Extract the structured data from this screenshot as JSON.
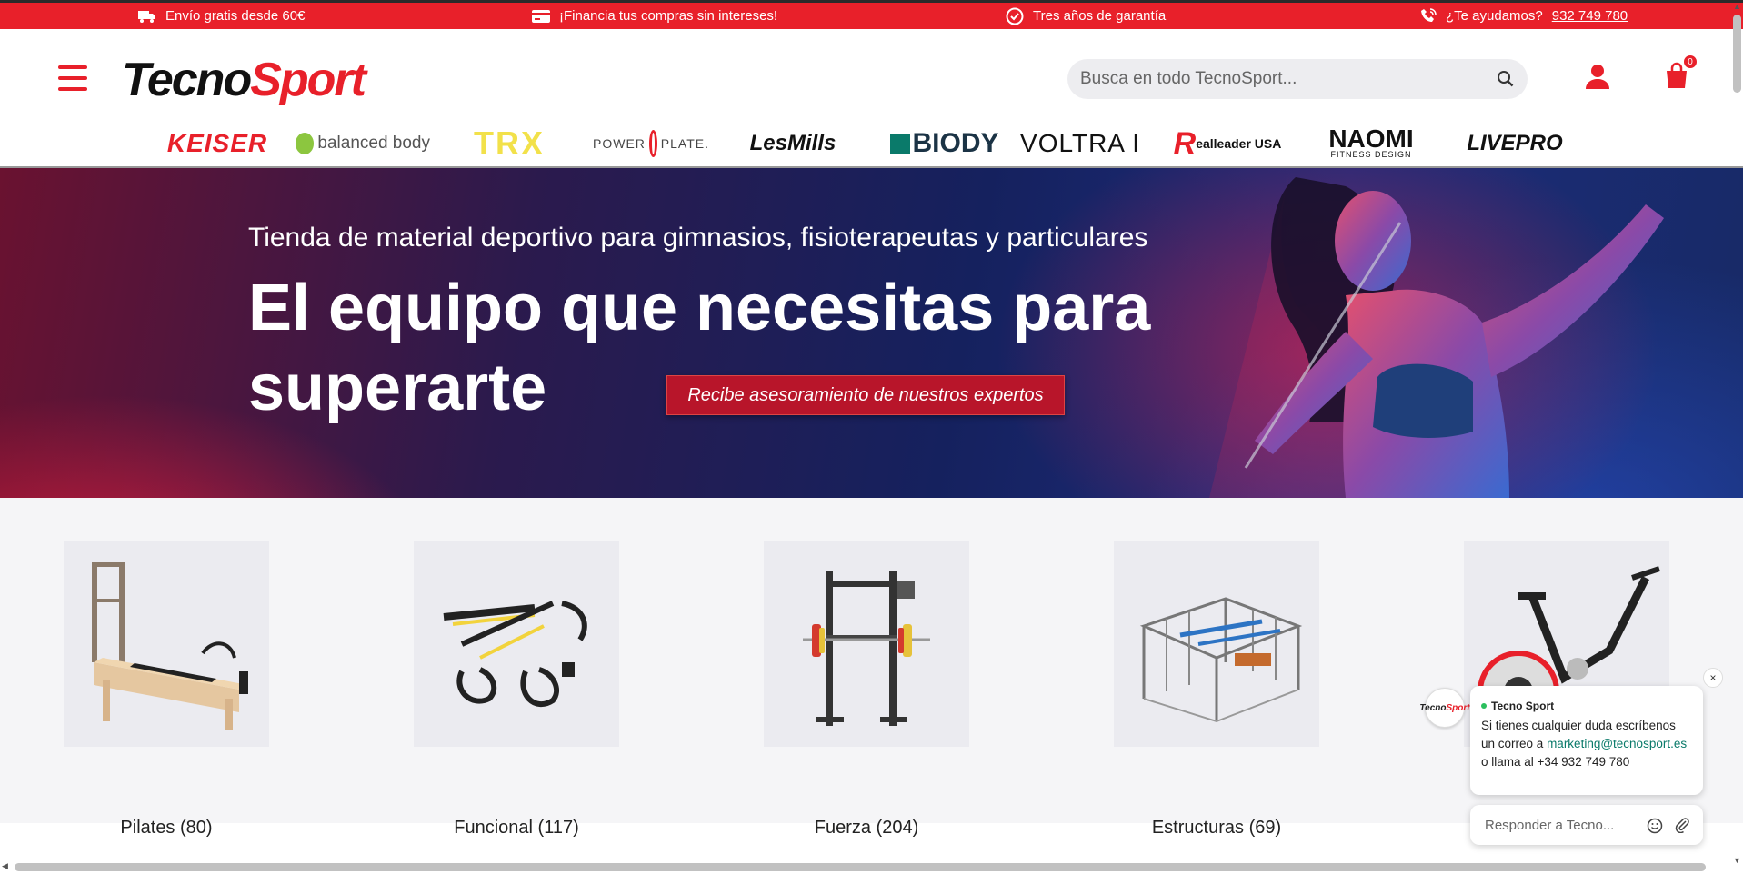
{
  "promo_bar": {
    "shipping": "Envío gratis desde 60€",
    "financing": "¡Financia tus compras sin intereses!",
    "warranty": "Tres años de garantía",
    "help_label": "¿Te ayudamos?",
    "help_phone": "932 749 780"
  },
  "header": {
    "logo_part1": "Tecno",
    "logo_part2": "Sport",
    "search_placeholder": "Busca en todo TecnoSport...",
    "cart_count": "0"
  },
  "brands": {
    "keiser": "KEISER",
    "balanced_body": "balanced body",
    "trx": "TRX",
    "power_plate_left": "POWER",
    "power_plate_right": "PLATE.",
    "lesmills": "LesMills",
    "biody": "BIODY",
    "voltra": "VOLTRA I",
    "realleader_r": "R",
    "realleader": "ealleader USA",
    "naomi": "NAOMI",
    "naomi_sub": "FITNESS DESIGN",
    "livepro": "LIVEPRO"
  },
  "hero": {
    "subtitle": "Tienda de material deportivo para gimnasios, fisioterapeutas y particulares",
    "title": "El equipo que necesitas para superarte",
    "cta": "Recibe asesoramiento de nuestros expertos"
  },
  "categories": [
    {
      "name": "Pilates",
      "count": "(80)"
    },
    {
      "name": "Funcional",
      "count": "(117)"
    },
    {
      "name": "Fuerza",
      "count": "(204)"
    },
    {
      "name": "Estructuras",
      "count": "(69)"
    },
    {
      "name": "",
      "count": "(..)"
    }
  ],
  "chat": {
    "avatar_part1": "Tecno",
    "avatar_part2": "Sport",
    "agent_name": "Tecno Sport",
    "message_pre": "Si tienes cualquier duda escríbenos un correo a",
    "email": "marketing@tecnosport.es",
    "message_post": "o llama al +34 932 749 780",
    "reply_placeholder": "Responder a Tecno...",
    "close_symbol": "×"
  },
  "colors": {
    "brand_red": "#e8202a",
    "cta_red": "#b8152a",
    "chat_link": "#0a7a6a"
  }
}
